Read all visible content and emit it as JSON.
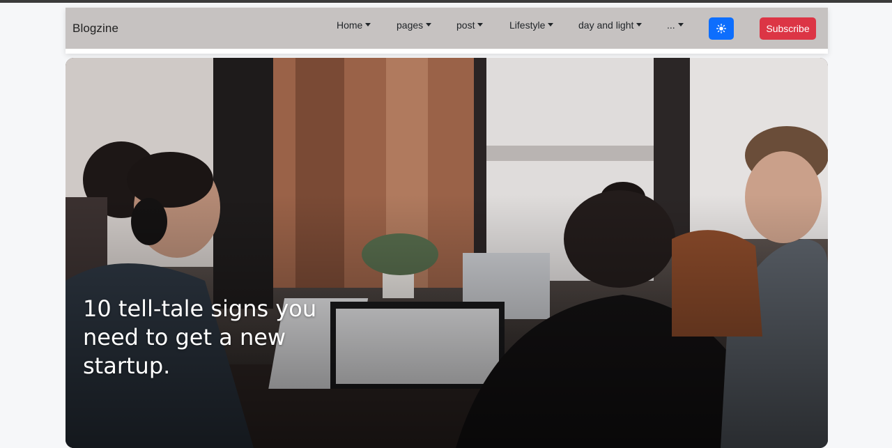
{
  "brand": "Blogzine",
  "nav": {
    "items": [
      {
        "label": "Home"
      },
      {
        "label": "pages"
      },
      {
        "label": "post"
      },
      {
        "label": "Lifestyle"
      },
      {
        "label": "day and light"
      },
      {
        "label": "..."
      }
    ],
    "theme_icon": "sun-icon",
    "subscribe_label": "Subscribe"
  },
  "hero": {
    "title": "10 tell-tale signs you need to get a new startup."
  },
  "colors": {
    "navbar_bg": "#c6c2c1",
    "theme_button": "#0d6efd",
    "subscribe_button": "#dc3545"
  }
}
